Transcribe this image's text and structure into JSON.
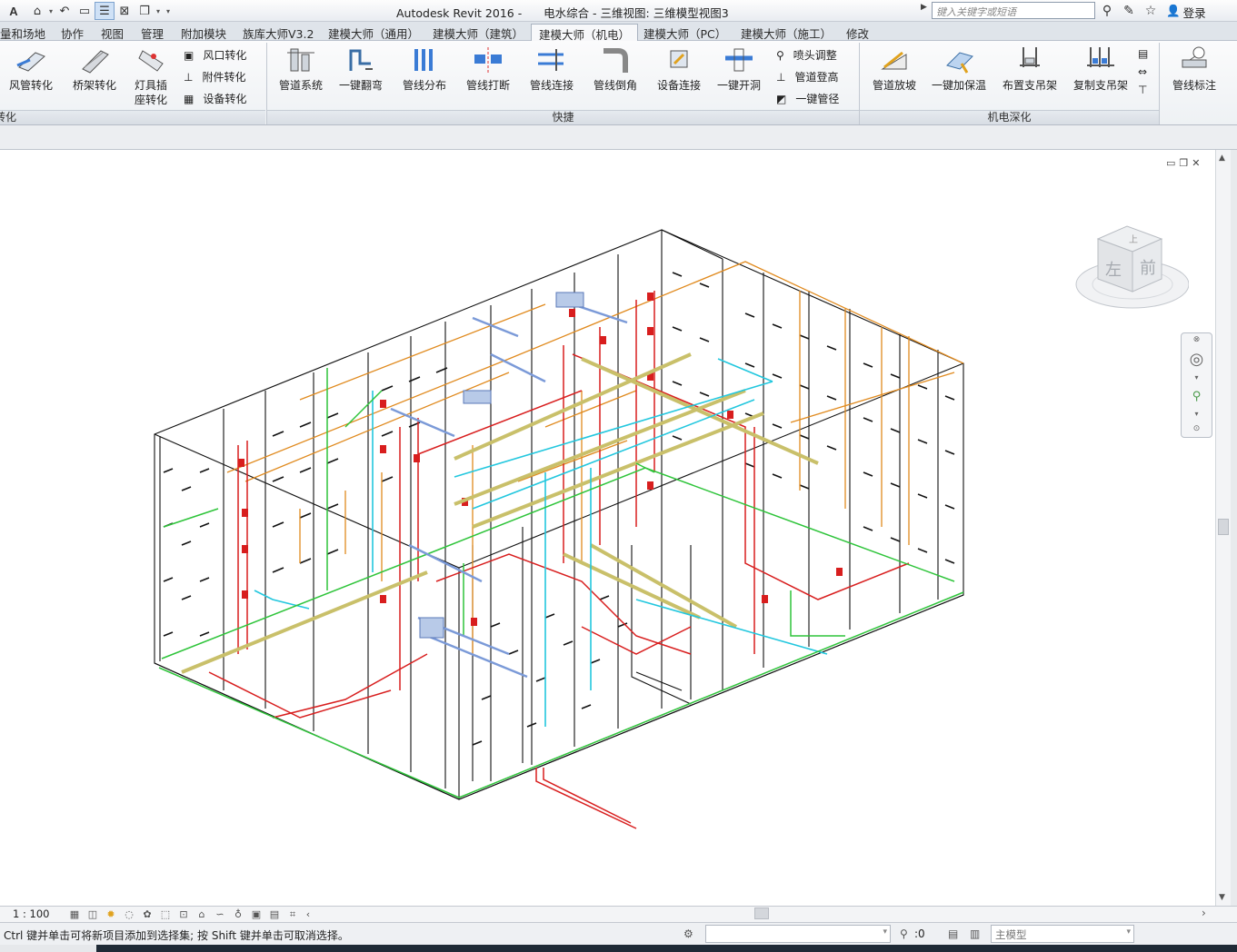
{
  "titlebar": {
    "app_title": "Autodesk Revit 2016 -",
    "doc_title": "电水综合 - 三维视图: 三维模型视图3",
    "search_placeholder": "键入关键字或短语",
    "login_label": "登录"
  },
  "tabs": [
    {
      "label": "量和场地"
    },
    {
      "label": "协作"
    },
    {
      "label": "视图"
    },
    {
      "label": "管理"
    },
    {
      "label": "附加模块"
    },
    {
      "label": "族库大师V3.2"
    },
    {
      "label": "建模大师（通用）"
    },
    {
      "label": "建模大师（建筑）"
    },
    {
      "label": "建模大师（机电）"
    },
    {
      "label": "建模大师（PC）"
    },
    {
      "label": "建模大师（施工）"
    },
    {
      "label": "修改"
    }
  ],
  "ribbon": {
    "conv": {
      "duct_convert": "风管转化",
      "tray_convert": "桥架转化",
      "lamp_convert_1": "灯具插",
      "lamp_convert_2": "座转化",
      "air_convert": "风口转化",
      "accessory_convert": "附件转化",
      "equipment_convert": "设备转化",
      "panel_label": "转化"
    },
    "quick": {
      "pipe_system": "管道系统",
      "one_click_bend": "一键翻弯",
      "pipe_distribute": "管线分布",
      "pipe_break": "管线打断",
      "pipe_connect": "管线连接",
      "pipe_chamfer": "管线倒角",
      "device_connect": "设备连接",
      "one_click_hole": "一键开洞",
      "sprinkler_adjust": "喷头调整",
      "pipe_elevate": "管道登高",
      "one_click_diameter": "一键管径",
      "panel_label": "快捷"
    },
    "mep": {
      "pipe_slope": "管道放坡",
      "one_click_insulation": "一键加保温",
      "place_hanger": "布置支吊架",
      "copy_hanger": "复制支吊架",
      "pipe_annotate": "管线标注",
      "panel_label": "机电深化"
    }
  },
  "viewcube": {
    "top_face": "上",
    "left_face": "左",
    "front_face": "前"
  },
  "viewbar": {
    "scale": "1 : 100"
  },
  "statusbar": {
    "message": "Ctrl 键并单击可将新项目添加到选择集; 按 Shift 键并单击可取消选择。",
    "selection_count": ":0",
    "model_combo": "主模型"
  },
  "colors": {
    "accent": "#cfe1f6",
    "fire_pipe": "#d81e1e",
    "water_supply": "#22c7de",
    "drain": "#e08a1e",
    "cable_tray": "#c9c06a",
    "spray": "#2ec43a",
    "duct": "#7b9ad8"
  },
  "icons": {
    "app": "revit-app-icon",
    "open": "open-icon",
    "undo": "undo-icon",
    "binoculars": "binoculars-icon",
    "star": "star-icon",
    "user": "user-icon"
  }
}
